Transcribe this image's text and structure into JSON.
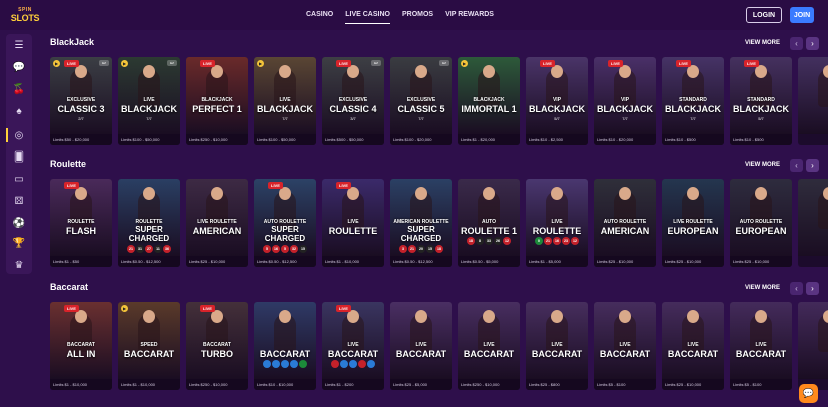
{
  "brand": {
    "logo_top": "SPIN",
    "logo_bottom": "SLOTS"
  },
  "nav": [
    {
      "label": "CASINO",
      "active": false
    },
    {
      "label": "LIVE CASINO",
      "active": true
    },
    {
      "label": "PROMOS",
      "active": false
    },
    {
      "label": "VIP REWARDS",
      "active": false
    }
  ],
  "auth": {
    "login_label": "LOGIN",
    "join_label": "JOIN"
  },
  "sidebar": {
    "items": [
      {
        "icon": "menu-icon",
        "glyph": "☰"
      },
      {
        "icon": "chat-bubbles-icon",
        "glyph": "💬"
      },
      {
        "icon": "cherries-icon",
        "glyph": "🍒"
      },
      {
        "icon": "spade-icon",
        "glyph": "♠"
      },
      {
        "icon": "live-dealer-icon",
        "glyph": "◎",
        "active": true
      },
      {
        "icon": "cards-icon",
        "glyph": "🂠"
      },
      {
        "icon": "laptop-icon",
        "glyph": "▭"
      },
      {
        "icon": "dice-icon",
        "glyph": "⚄"
      },
      {
        "icon": "sports-ball-icon",
        "glyph": "⚽"
      },
      {
        "icon": "trophy-icon",
        "glyph": "🏆"
      },
      {
        "icon": "crown-icon",
        "glyph": "♛"
      }
    ]
  },
  "view_more_label": "VIEW MORE",
  "sections": [
    {
      "title": "BlackJack",
      "cards": [
        {
          "sub": "EXCLUSIVE",
          "main": "CLASSIC 3",
          "seats": "2/7",
          "limits": "Limits $50 - $20,000",
          "bg": "#3b3e44",
          "live": "LIVE",
          "prov": "EZ",
          "play": true
        },
        {
          "sub": "LIVE",
          "main": "BLACKJACK",
          "seats": "7/7",
          "limits": "Limits $100 - $50,000",
          "bg": "#2c3a32",
          "live": "",
          "prov": "EZ",
          "play": true
        },
        {
          "sub": "BLACKJACK",
          "main": "PERFECT 1",
          "seats": "",
          "limits": "Limits $250 - $10,000",
          "bg": "#6a2a2a",
          "live": "LIVE",
          "prov": "",
          "play": false
        },
        {
          "sub": "LIVE",
          "main": "BLACKJACK",
          "seats": "7/7",
          "limits": "Limits $100 - $50,000",
          "bg": "#5a4634",
          "live": "",
          "prov": "",
          "play": true
        },
        {
          "sub": "EXCLUSIVE",
          "main": "CLASSIC 4",
          "seats": "3/7",
          "limits": "Limits $500 - $50,000",
          "bg": "#3d3f44",
          "live": "LIVE",
          "prov": "EZ",
          "play": false
        },
        {
          "sub": "EXCLUSIVE",
          "main": "CLASSIC 5",
          "seats": "7/7",
          "limits": "Limits $100 - $20,000",
          "bg": "#3a3c41",
          "live": "",
          "prov": "EZ",
          "play": false
        },
        {
          "sub": "BLACKJACK",
          "main": "IMMORTAL 1",
          "seats": "",
          "limits": "Limits $1 - $20,000",
          "bg": "#2d5a3a",
          "live": "",
          "prov": "",
          "play": true
        },
        {
          "sub": "VIP",
          "main": "BLACKJACK",
          "seats": "5/7",
          "limits": "Limits $10 - $2,500",
          "bg": "#4a3468",
          "live": "LIVE",
          "prov": "",
          "play": false
        },
        {
          "sub": "VIP",
          "main": "BLACKJACK",
          "seats": "7/7",
          "limits": "Limits $10 - $20,000",
          "bg": "#4a3068",
          "live": "LIVE",
          "prov": "",
          "play": false
        },
        {
          "sub": "STANDARD",
          "main": "BLACKJACK",
          "seats": "7/7",
          "limits": "Limits $10 - $500",
          "bg": "#463366",
          "live": "LIVE",
          "prov": "",
          "play": false
        },
        {
          "sub": "STANDARD",
          "main": "BLACKJACK",
          "seats": "5/7",
          "limits": "Limits $10 - $500",
          "bg": "#45315f",
          "live": "LIVE",
          "prov": "",
          "play": false
        },
        {
          "sub": "",
          "main": "",
          "seats": "",
          "limits": "",
          "bg": "#43305f",
          "live": "",
          "prov": "",
          "play": false
        }
      ]
    },
    {
      "title": "Roulette",
      "cards": [
        {
          "sub": "ROULETTE",
          "main": "FLASH",
          "seats": "",
          "limits": "Limits $1 - $50",
          "bg": "#4a2a5a",
          "live": "LIVE",
          "prov": "",
          "play": false,
          "nums": []
        },
        {
          "sub": "ROULETTE",
          "main": "SUPER CHARGED",
          "seats": "",
          "limits": "Limits $0.50 - $12,500",
          "bg": "#2a3f63",
          "live": "",
          "prov": "",
          "play": false,
          "nums": [
            [
              "21",
              "#c4212a"
            ],
            [
              "31",
              "#222"
            ],
            [
              "27",
              "#c4212a"
            ],
            [
              "11",
              "#222"
            ],
            [
              "36",
              "#c4212a"
            ]
          ]
        },
        {
          "sub": "LIVE ROULETTE",
          "main": "AMERICAN",
          "seats": "",
          "limits": "Limits $25 - $10,000",
          "bg": "#3d2a44",
          "live": "",
          "prov": "",
          "play": false,
          "nums": []
        },
        {
          "sub": "AUTO ROULETTE",
          "main": "SUPER CHARGED",
          "seats": "",
          "limits": "Limits $0.50 - $12,500",
          "bg": "#2c4266",
          "live": "LIVE",
          "prov": "",
          "play": false,
          "nums": [
            [
              "5",
              "#c4212a"
            ],
            [
              "16",
              "#c4212a"
            ],
            [
              "5",
              "#c4212a"
            ],
            [
              "32",
              "#c4212a"
            ],
            [
              "15",
              "#222"
            ]
          ]
        },
        {
          "sub": "LIVE",
          "main": "ROULETTE",
          "seats": "",
          "limits": "Limits $1 - $10,000",
          "bg": "#3b2a6a",
          "live": "LIVE",
          "prov": "",
          "play": false,
          "nums": []
        },
        {
          "sub": "AMERICAN ROULETTE",
          "main": "SUPER CHARGED",
          "seats": "",
          "limits": "Limits $0.50 - $12,500",
          "bg": "#2b4064",
          "live": "",
          "prov": "",
          "play": false,
          "nums": [
            [
              "3",
              "#c4212a"
            ],
            [
              "21",
              "#c4212a"
            ],
            [
              "20",
              "#222"
            ],
            [
              "15",
              "#222"
            ],
            [
              "18",
              "#c4212a"
            ]
          ]
        },
        {
          "sub": "AUTO",
          "main": "ROULETTE 1",
          "seats": "",
          "limits": "Limits $0.50 - $5,000",
          "bg": "#3a2a4a",
          "live": "",
          "prov": "",
          "play": false,
          "nums": [
            [
              "18",
              "#c4212a"
            ],
            [
              "8",
              "#222"
            ],
            [
              "33",
              "#222"
            ],
            [
              "26",
              "#222"
            ],
            [
              "12",
              "#c4212a"
            ]
          ]
        },
        {
          "sub": "LIVE",
          "main": "ROULETTE",
          "seats": "",
          "limits": "Limits $1 - $5,000",
          "bg": "#4a3770",
          "live": "",
          "prov": "",
          "play": false,
          "nums": [
            [
              "0",
              "#1c8a3a"
            ],
            [
              "21",
              "#c4212a"
            ],
            [
              "16",
              "#c4212a"
            ],
            [
              "23",
              "#c4212a"
            ],
            [
              "12",
              "#c4212a"
            ]
          ]
        },
        {
          "sub": "AUTO ROULETTE",
          "main": "AMERICAN",
          "seats": "",
          "limits": "Limits $25 - $10,000",
          "bg": "#2f2f3a",
          "live": "",
          "prov": "",
          "play": false,
          "nums": []
        },
        {
          "sub": "LIVE ROULETTE",
          "main": "EUROPEAN",
          "seats": "",
          "limits": "Limits $25 - $10,000",
          "bg": "#24364f",
          "live": "",
          "prov": "",
          "play": false,
          "nums": []
        },
        {
          "sub": "AUTO ROULETTE",
          "main": "EUROPEAN",
          "seats": "",
          "limits": "Limits $25 - $10,000",
          "bg": "#2e2c3e",
          "live": "",
          "prov": "",
          "play": false,
          "nums": []
        },
        {
          "sub": "",
          "main": "",
          "seats": "",
          "limits": "",
          "bg": "#2f2c3c",
          "live": "",
          "prov": "",
          "play": false,
          "nums": []
        }
      ]
    },
    {
      "title": "Baccarat",
      "cards": [
        {
          "sub": "BACCARAT",
          "main": "ALL IN",
          "seats": "",
          "limits": "Limits $1 - $10,000",
          "bg": "#6a3030",
          "live": "LIVE",
          "prov": "",
          "play": false,
          "nums": []
        },
        {
          "sub": "SPEED",
          "main": "BACCARAT",
          "seats": "",
          "limits": "Limits $1 - $10,000",
          "bg": "#5a3a2a",
          "live": "",
          "prov": "",
          "play": true,
          "nums": []
        },
        {
          "sub": "BACCARAT",
          "main": "TURBO",
          "seats": "",
          "limits": "Limits $250 - $10,000",
          "bg": "#44303a",
          "live": "LIVE",
          "prov": "",
          "play": false,
          "nums": []
        },
        {
          "sub": "",
          "main": "BACCARAT",
          "seats": "",
          "limits": "Limits $10 - $10,000",
          "bg": "#2f3a66",
          "live": "",
          "prov": "",
          "play": false,
          "nums": [
            [
              "",
              "#2a7bd6"
            ],
            [
              "",
              "#2a7bd6"
            ],
            [
              "",
              "#2a7bd6"
            ],
            [
              "",
              "#2a7bd6"
            ],
            [
              "",
              "#1c8a3a"
            ]
          ]
        },
        {
          "sub": "LIVE",
          "main": "BACCARAT",
          "seats": "",
          "limits": "Limits $1 - $200",
          "bg": "#3a3560",
          "live": "LIVE",
          "prov": "",
          "play": false,
          "nums": [
            [
              "",
              "#c4212a"
            ],
            [
              "",
              "#2a7bd6"
            ],
            [
              "",
              "#2a7bd6"
            ],
            [
              "",
              "#c4212a"
            ],
            [
              "",
              "#2a7bd6"
            ]
          ]
        },
        {
          "sub": "LIVE",
          "main": "BACCARAT",
          "seats": "",
          "limits": "Limits $25 - $5,000",
          "bg": "#4a2f63",
          "live": "",
          "prov": "",
          "play": false,
          "nums": []
        },
        {
          "sub": "LIVE",
          "main": "BACCARAT",
          "seats": "",
          "limits": "Limits $250 - $10,000",
          "bg": "#482e60",
          "live": "",
          "prov": "",
          "play": false,
          "nums": []
        },
        {
          "sub": "LIVE",
          "main": "BACCARAT",
          "seats": "",
          "limits": "Limits $25 - $800",
          "bg": "#472e5e",
          "live": "",
          "prov": "",
          "play": false,
          "nums": []
        },
        {
          "sub": "LIVE",
          "main": "BACCARAT",
          "seats": "",
          "limits": "Limits $5 - $100",
          "bg": "#462d5d",
          "live": "",
          "prov": "",
          "play": false,
          "nums": []
        },
        {
          "sub": "LIVE",
          "main": "BACCARAT",
          "seats": "",
          "limits": "Limits $25 - $10,000",
          "bg": "#452c5c",
          "live": "",
          "prov": "",
          "play": false,
          "nums": []
        },
        {
          "sub": "LIVE",
          "main": "BACCARAT",
          "seats": "",
          "limits": "Limits $5 - $100",
          "bg": "#442b5b",
          "live": "",
          "prov": "",
          "play": false,
          "nums": []
        },
        {
          "sub": "",
          "main": "",
          "seats": "",
          "limits": "",
          "bg": "#432a5a",
          "live": "",
          "prov": "",
          "play": false,
          "nums": []
        }
      ]
    }
  ]
}
